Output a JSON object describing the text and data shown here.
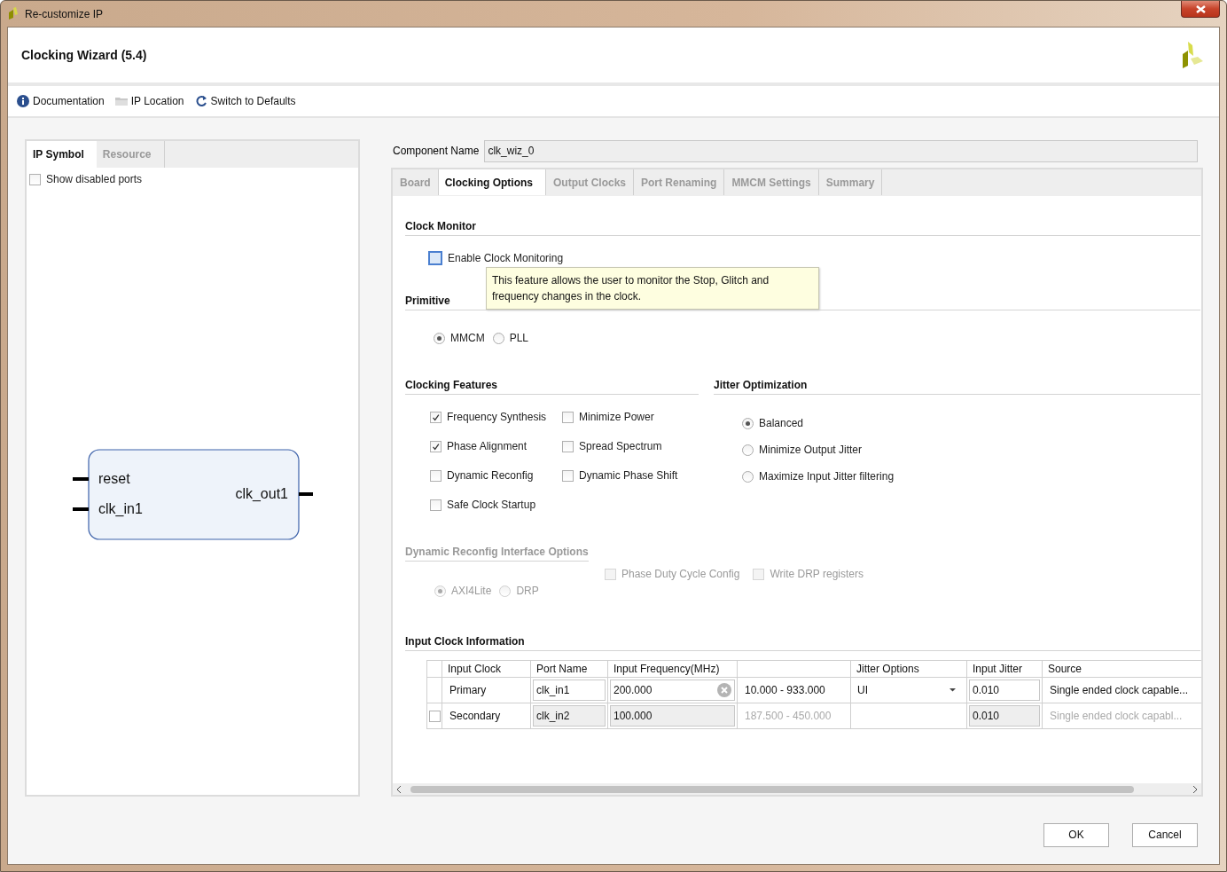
{
  "window": {
    "title": "Re-customize IP"
  },
  "header": {
    "title": "Clocking Wizard (5.4)"
  },
  "toolbar": [
    {
      "label": "Documentation",
      "kind": "info"
    },
    {
      "label": "IP Location",
      "kind": "folder"
    },
    {
      "label": "Switch to Defaults",
      "kind": "refresh"
    }
  ],
  "left_tabs": [
    {
      "label": "IP Symbol",
      "selected": true
    },
    {
      "label": "Resource",
      "selected": false
    }
  ],
  "show_disabled_ports": {
    "label": "Show disabled ports",
    "checked": false
  },
  "symbol": {
    "inputs": [
      "reset",
      "clk_in1"
    ],
    "outputs": [
      "clk_out1"
    ]
  },
  "component_name": {
    "label": "Component Name",
    "value": "clk_wiz_0"
  },
  "tabs": [
    {
      "label": "Board",
      "selected": false
    },
    {
      "label": "Clocking Options",
      "selected": true
    },
    {
      "label": "Output Clocks",
      "selected": false
    },
    {
      "label": "Port Renaming",
      "selected": false
    },
    {
      "label": "MMCM Settings",
      "selected": false
    },
    {
      "label": "Summary",
      "selected": false
    }
  ],
  "clock_monitor": {
    "title": "Clock Monitor",
    "option": {
      "label": "Enable Clock Monitoring",
      "checked": false,
      "focused": true
    },
    "tooltip": "This feature allows the user to monitor the Stop, Glitch and frequency changes in the clock."
  },
  "primitive": {
    "title": "Primitive",
    "options": [
      {
        "label": "MMCM",
        "selected": true
      },
      {
        "label": "PLL",
        "selected": false
      }
    ]
  },
  "clocking_features": {
    "title": "Clocking Features",
    "options": [
      {
        "label": "Frequency Synthesis",
        "checked": true
      },
      {
        "label": "Minimize Power",
        "checked": false
      },
      {
        "label": "Phase Alignment",
        "checked": true
      },
      {
        "label": "Spread Spectrum",
        "checked": false
      },
      {
        "label": "Dynamic Reconfig",
        "checked": false
      },
      {
        "label": "Dynamic Phase Shift",
        "checked": false
      },
      {
        "label": "Safe Clock Startup",
        "checked": false
      }
    ]
  },
  "jitter_optimization": {
    "title": "Jitter Optimization",
    "options": [
      {
        "label": "Balanced",
        "selected": true
      },
      {
        "label": "Minimize Output Jitter",
        "selected": false
      },
      {
        "label": "Maximize Input Jitter filtering",
        "selected": false
      }
    ]
  },
  "dynamic_reconfig": {
    "title": "Dynamic Reconfig Interface Options",
    "disabled": true,
    "options": [
      {
        "label": "Phase Duty Cycle Config",
        "checked": false
      },
      {
        "label": "Write DRP registers",
        "checked": false
      }
    ],
    "interface": [
      {
        "label": "AXI4Lite",
        "selected": true
      },
      {
        "label": "DRP",
        "selected": false
      }
    ]
  },
  "input_clock_information": {
    "title": "Input Clock Information",
    "columns": [
      "Input Clock",
      "Port Name",
      "Input Frequency(MHz)",
      "Jitter Options",
      "Input Jitter",
      "Source"
    ],
    "rows": [
      {
        "kind": "fixed",
        "enabled": true,
        "input_clock": "Primary",
        "port_name": "clk_in1",
        "frequency": "200.000",
        "range": "10.000 - 933.000",
        "jitter_option": "UI",
        "input_jitter": "0.010",
        "source": "Single ended clock capable..."
      },
      {
        "kind": "optional",
        "checked": false,
        "enabled": false,
        "input_clock": "Secondary",
        "port_name": "clk_in2",
        "frequency": "100.000",
        "range": "187.500 - 450.000",
        "input_jitter": "0.010",
        "source": "Single ended clock capabl..."
      }
    ]
  },
  "buttons": [
    {
      "label": "OK"
    },
    {
      "label": "Cancel"
    }
  ]
}
